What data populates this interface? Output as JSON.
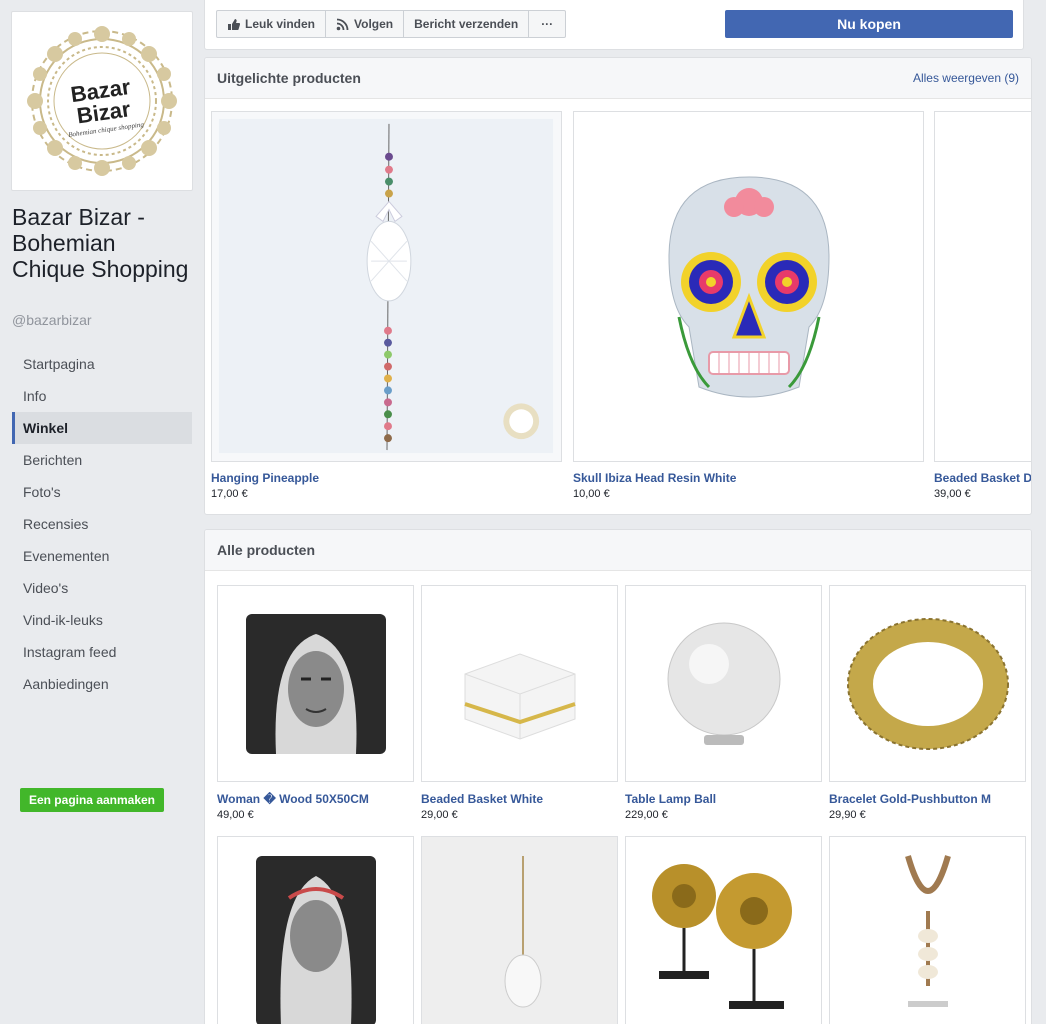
{
  "page": {
    "logo_text_1": "Bazar",
    "logo_text_2": "Bizar",
    "logo_tagline": "Bohemian chique shopping",
    "name": "Bazar Bizar - Bohemian Chique Shopping",
    "handle": "@bazarbizar"
  },
  "nav": {
    "items": [
      "Startpagina",
      "Info",
      "Winkel",
      "Berichten",
      "Foto's",
      "Recensies",
      "Evenementen",
      "Video's",
      "Vind-ik-leuks",
      "Instagram feed",
      "Aanbiedingen"
    ],
    "active": "Winkel"
  },
  "create_page_label": "Een pagina aanmaken",
  "actions": {
    "like": "Leuk vinden",
    "follow": "Volgen",
    "message": "Bericht verzenden",
    "more": "···",
    "buy": "Nu kopen"
  },
  "featured": {
    "title": "Uitgelichte producten",
    "see_all": "Alles weergeven (9)",
    "products": [
      {
        "name": "Hanging Pineapple",
        "price": "17,00 €"
      },
      {
        "name": "Skull Ibiza Head Resin White",
        "price": "10,00 €"
      },
      {
        "name": "Beaded Basket D",
        "price": "39,00 €"
      }
    ]
  },
  "all_products": {
    "title": "Alle producten",
    "products": [
      {
        "name": "Woman � Wood 50X50CM",
        "price": "49,00 €"
      },
      {
        "name": "Beaded Basket White",
        "price": "29,00 €"
      },
      {
        "name": "Table Lamp Ball",
        "price": "229,00 €"
      },
      {
        "name": "Bracelet Gold-Pushbutton M",
        "price": "29,90 €"
      }
    ]
  },
  "colors": {
    "brand_blue": "#4267b2",
    "link_blue": "#365899",
    "green": "#42b72a",
    "background": "#e9ebee"
  }
}
